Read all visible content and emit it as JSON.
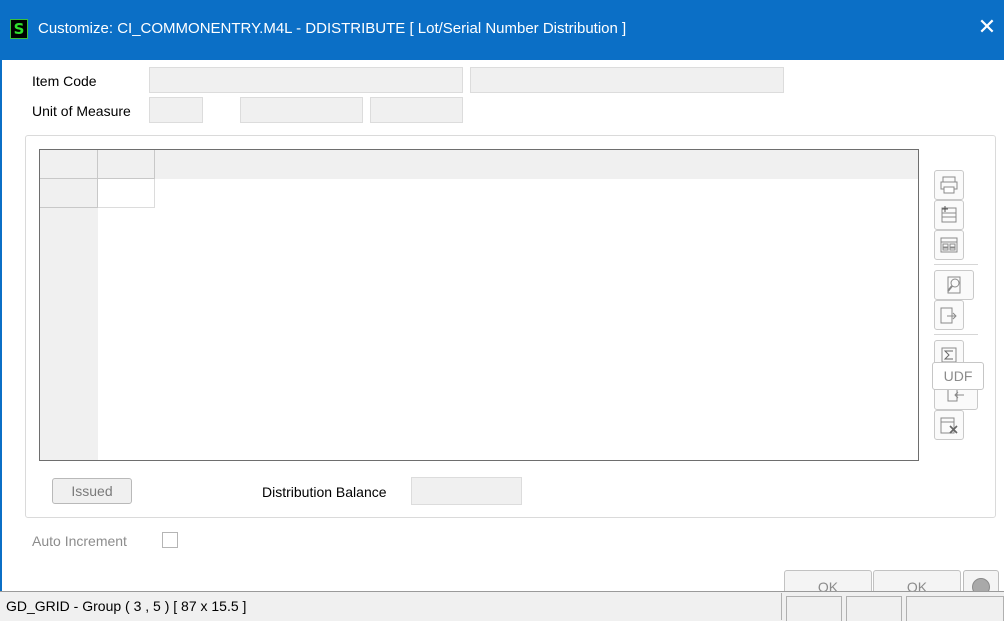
{
  "window": {
    "app_icon_glyph": "S",
    "title": "Customize: CI_COMMONENTRY.M4L - DDISTRIBUTE  [ Lot/Serial Number Distribution ]",
    "close_glyph": "✕"
  },
  "form": {
    "item_code_label": "Item Code",
    "item_code_value": "",
    "item_desc_value": "",
    "unit_of_measure_label": "Unit of Measure",
    "uom_value": "",
    "uom_field2_value": "",
    "uom_field3_value": ""
  },
  "toolbar": {
    "icons": [
      "print-icon",
      "insert-row-icon",
      "grid-settings-icon",
      "lookup-icon",
      "export-icon",
      "totals-icon",
      "import-icon",
      "delete-icon"
    ],
    "udf_label": "UDF"
  },
  "issued_label": "Issued",
  "distribution_balance_label": "Distribution Balance",
  "distribution_balance_value": "",
  "auto_increment_label": "Auto Increment",
  "auto_increment_checked": false,
  "buttons": {
    "ok1_label": "OK",
    "ok2_label": "OK",
    "help_icon": "help-icon"
  },
  "statusbar": {
    "text": "GD_GRID - Group  ( 3 , 5 )  [ 87 x 15.5 ]"
  },
  "colors": {
    "titlebar": "#0b6fc6",
    "app_icon_bg": "#000000",
    "app_icon_fg": "#2ee02e",
    "disabled_text": "#8c8c8c"
  }
}
